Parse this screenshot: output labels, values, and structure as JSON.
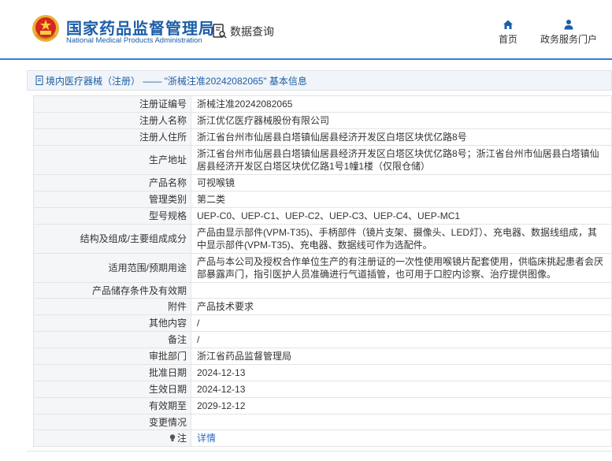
{
  "header": {
    "brand_cn": "国家药品监督管理局",
    "brand_en": "National Medical Products Administration",
    "search_label": "数据查询",
    "nav": [
      {
        "label": "首页",
        "icon": "home-icon"
      },
      {
        "label": "政务服务门户",
        "icon": "user-icon"
      }
    ]
  },
  "section": {
    "title": "境内医疗器械（注册） —— \"浙械注准20242082065\" 基本信息"
  },
  "details": {
    "rows": [
      {
        "label": "注册证编号",
        "value": "浙械注准20242082065"
      },
      {
        "label": "注册人名称",
        "value": "浙江优亿医疗器械股份有限公司"
      },
      {
        "label": "注册人住所",
        "value": "浙江省台州市仙居县白塔镇仙居县经济开发区白塔区块优亿路8号"
      },
      {
        "label": "生产地址",
        "value": "浙江省台州市仙居县白塔镇仙居县经济开发区白塔区块优亿路8号；浙江省台州市仙居县白塔镇仙居县经济开发区白塔区块优亿路1号1幢1楼（仅限仓储）"
      },
      {
        "label": "产品名称",
        "value": "可视喉镜"
      },
      {
        "label": "管理类别",
        "value": "第二类"
      },
      {
        "label": "型号规格",
        "value": "UEP-C0、UEP-C1、UEP-C2、UEP-C3、UEP-C4、UEP-MC1"
      },
      {
        "label": "结构及组成/主要组成成分",
        "value": "产品由显示部件(VPM-T35)、手柄部件（镜片支架、摄像头、LED灯）、充电器、数据线组成，其中显示部件(VPM-T35)、充电器、数据线可作为选配件。"
      },
      {
        "label": "适用范围/预期用途",
        "value": "产品与本公司及授权合作单位生产的有注册证的一次性使用喉镜片配套使用，供临床挑起患者会厌部暴露声门，指引医护人员准确进行气道插管，也可用于口腔内诊察、治疗提供图像。"
      },
      {
        "label": "产品储存条件及有效期",
        "value": ""
      },
      {
        "label": "附件",
        "value": "产品技术要求"
      },
      {
        "label": "其他内容",
        "value": "/"
      },
      {
        "label": "备注",
        "value": "/"
      },
      {
        "label": "审批部门",
        "value": "浙江省药品监督管理局"
      },
      {
        "label": "批准日期",
        "value": "2024-12-13"
      },
      {
        "label": "生效日期",
        "value": "2024-12-13"
      },
      {
        "label": "有效期至",
        "value": "2029-12-12"
      },
      {
        "label": "变更情况",
        "value": ""
      },
      {
        "label": "注",
        "value": "详情"
      }
    ]
  },
  "colors": {
    "brand": "#1c5ea8",
    "link": "#2a6bc2",
    "label_bg": "#f5f6f8"
  }
}
